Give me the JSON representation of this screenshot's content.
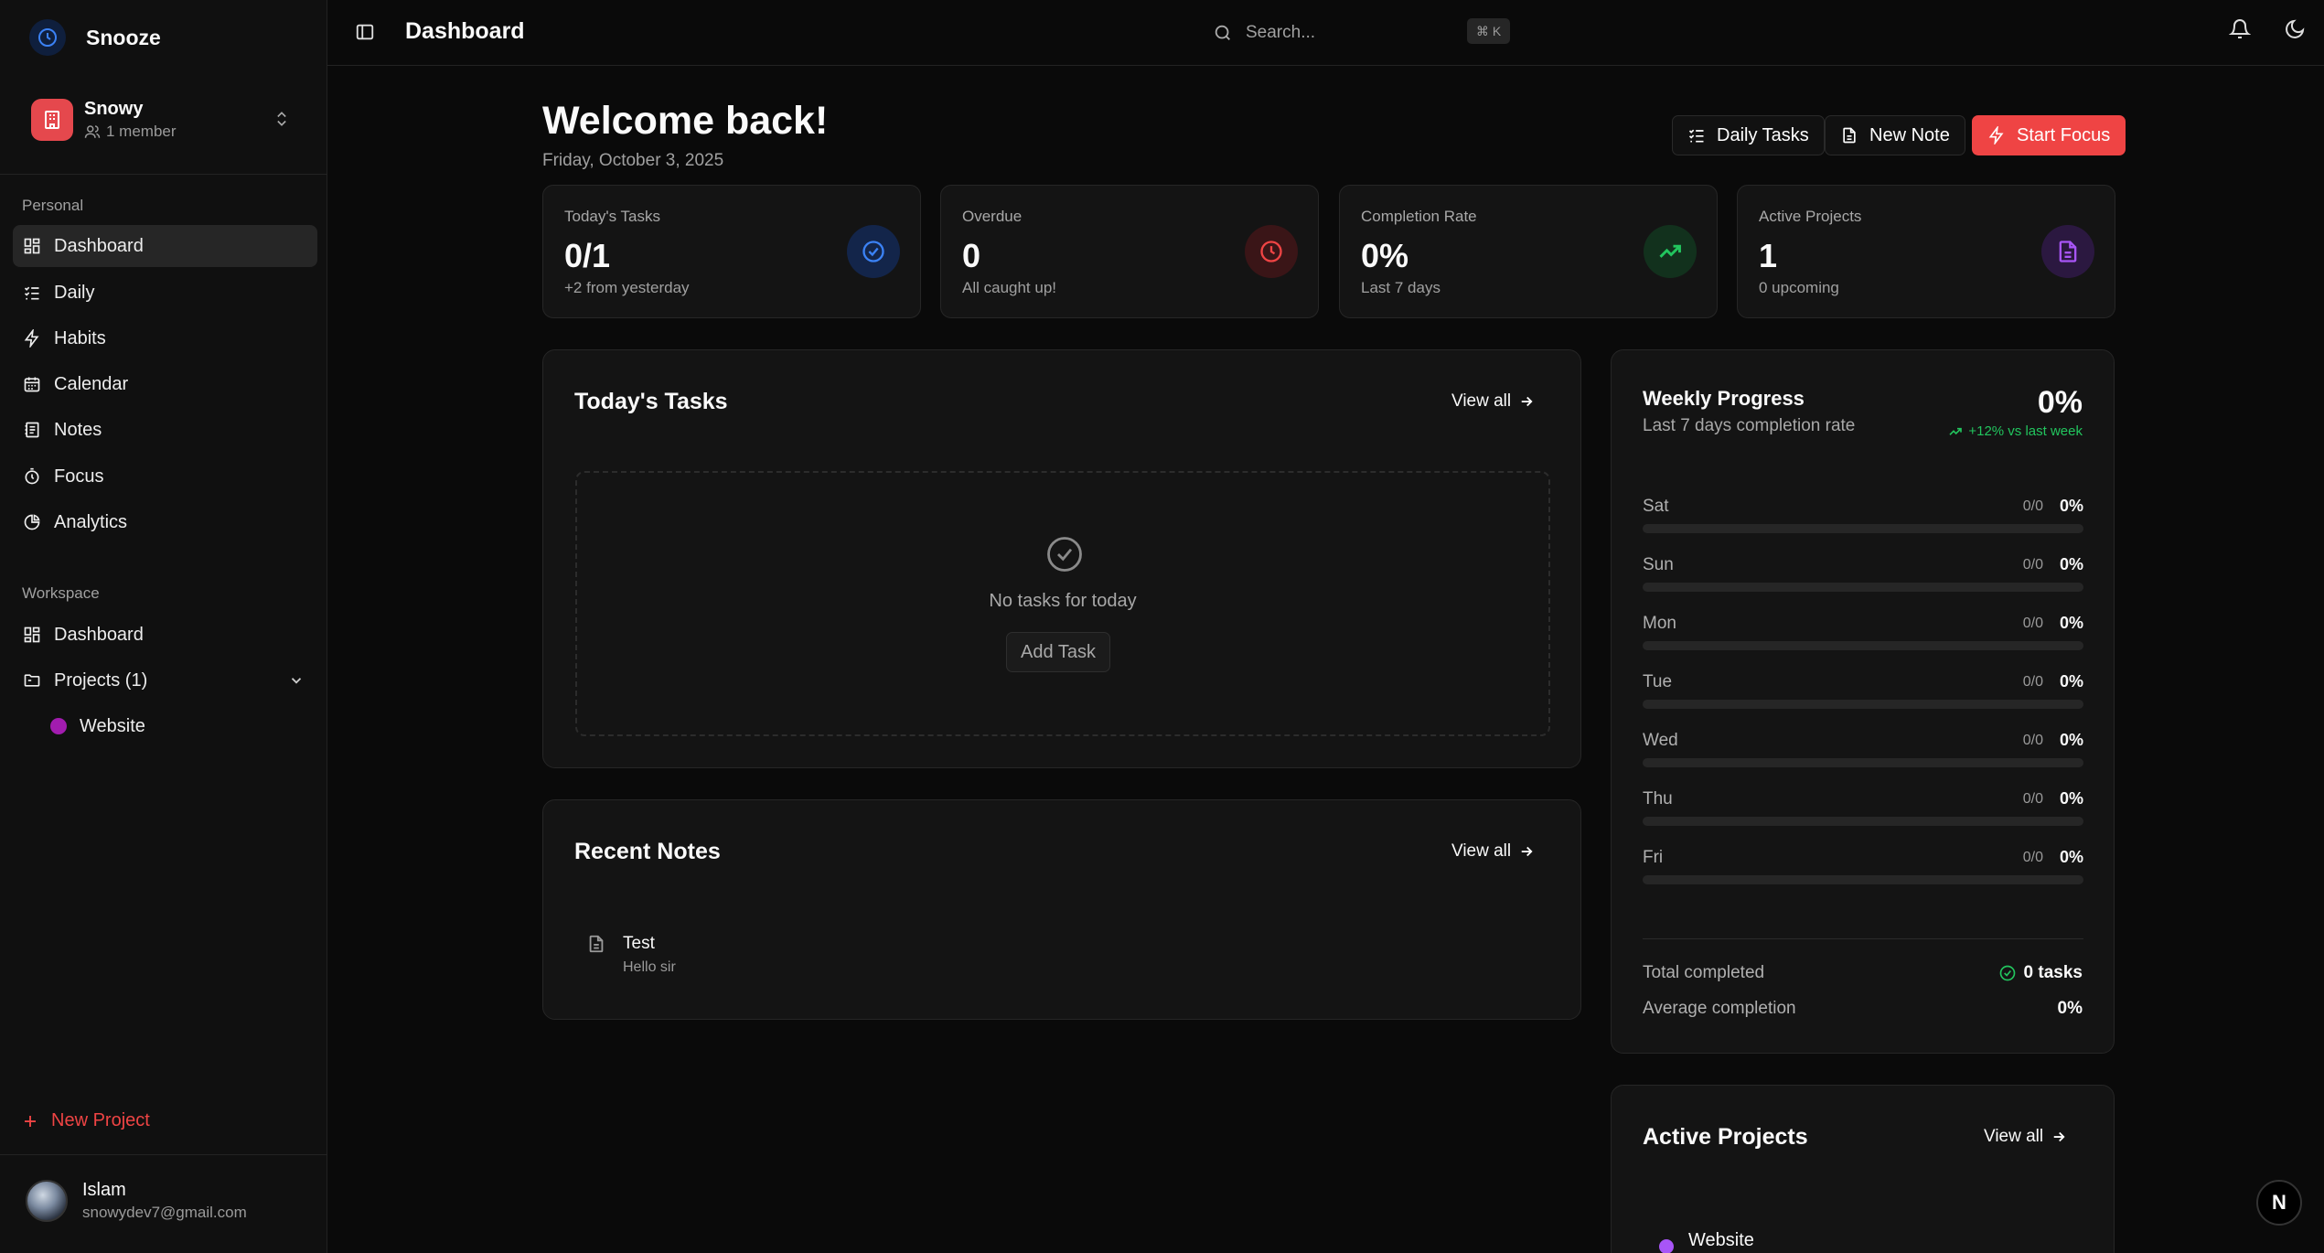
{
  "app": {
    "name": "Snooze"
  },
  "team": {
    "name": "Snowy",
    "members": "1 member"
  },
  "sidebar": {
    "personal_label": "Personal",
    "personal_items": [
      {
        "label": "Dashboard",
        "icon": "dashboard-icon"
      },
      {
        "label": "Daily",
        "icon": "list-check-icon"
      },
      {
        "label": "Habits",
        "icon": "bolt-icon"
      },
      {
        "label": "Calendar",
        "icon": "calendar-icon"
      },
      {
        "label": "Notes",
        "icon": "notebook-icon"
      },
      {
        "label": "Focus",
        "icon": "timer-icon"
      },
      {
        "label": "Analytics",
        "icon": "pie-chart-icon"
      }
    ],
    "workspace_label": "Workspace",
    "workspace_items": [
      {
        "label": "Dashboard",
        "icon": "dashboard-icon"
      },
      {
        "label": "Projects (1)",
        "icon": "folder-icon"
      }
    ],
    "projects": [
      {
        "label": "Website",
        "color": "#a21caf"
      }
    ],
    "new_project": "New Project"
  },
  "user": {
    "name": "Islam",
    "email": "snowydev7@gmail.com"
  },
  "topbar": {
    "title": "Dashboard",
    "search_placeholder": "Search...",
    "shortcut": "⌘ K"
  },
  "header": {
    "welcome": "Welcome back!",
    "date": "Friday, October 3, 2025",
    "daily_tasks": "Daily Tasks",
    "new_note": "New Note",
    "start_focus": "Start Focus"
  },
  "stats": [
    {
      "label": "Today's Tasks",
      "value": "0/1",
      "sub": "+2 from yesterday",
      "icon": "check-circle-icon",
      "color": "#3b82f6"
    },
    {
      "label": "Overdue",
      "value": "0",
      "sub": "All caught up!",
      "icon": "clock-icon",
      "color": "#ef4444"
    },
    {
      "label": "Completion Rate",
      "value": "0%",
      "sub": "Last 7 days",
      "icon": "trending-up-icon",
      "color": "#22c55e"
    },
    {
      "label": "Active Projects",
      "value": "1",
      "sub": "0 upcoming",
      "icon": "document-icon",
      "color": "#a855f7"
    }
  ],
  "tasks_card": {
    "title": "Today's Tasks",
    "view_all": "View all",
    "empty": "No tasks for today",
    "add_task": "Add Task"
  },
  "notes_card": {
    "title": "Recent Notes",
    "view_all": "View all",
    "notes": [
      {
        "title": "Test",
        "preview": "Hello sir"
      }
    ]
  },
  "weekly": {
    "title": "Weekly Progress",
    "subtitle": "Last 7 days completion rate",
    "percent": "0%",
    "trend": "+12% vs last week",
    "days": [
      {
        "day": "Sat",
        "count": "0/0",
        "pct": "0%",
        "fill": 0
      },
      {
        "day": "Sun",
        "count": "0/0",
        "pct": "0%",
        "fill": 0
      },
      {
        "day": "Mon",
        "count": "0/0",
        "pct": "0%",
        "fill": 0
      },
      {
        "day": "Tue",
        "count": "0/0",
        "pct": "0%",
        "fill": 0
      },
      {
        "day": "Wed",
        "count": "0/0",
        "pct": "0%",
        "fill": 0
      },
      {
        "day": "Thu",
        "count": "0/0",
        "pct": "0%",
        "fill": 0
      },
      {
        "day": "Fri",
        "count": "0/0",
        "pct": "0%",
        "fill": 0
      }
    ],
    "total_label": "Total completed",
    "total_value": "0 tasks",
    "avg_label": "Average completion",
    "avg_value": "0%"
  },
  "projects_card": {
    "title": "Active Projects",
    "view_all": "View all",
    "items": [
      {
        "name": "Website",
        "color": "#a855f7"
      }
    ]
  },
  "badge": "N"
}
